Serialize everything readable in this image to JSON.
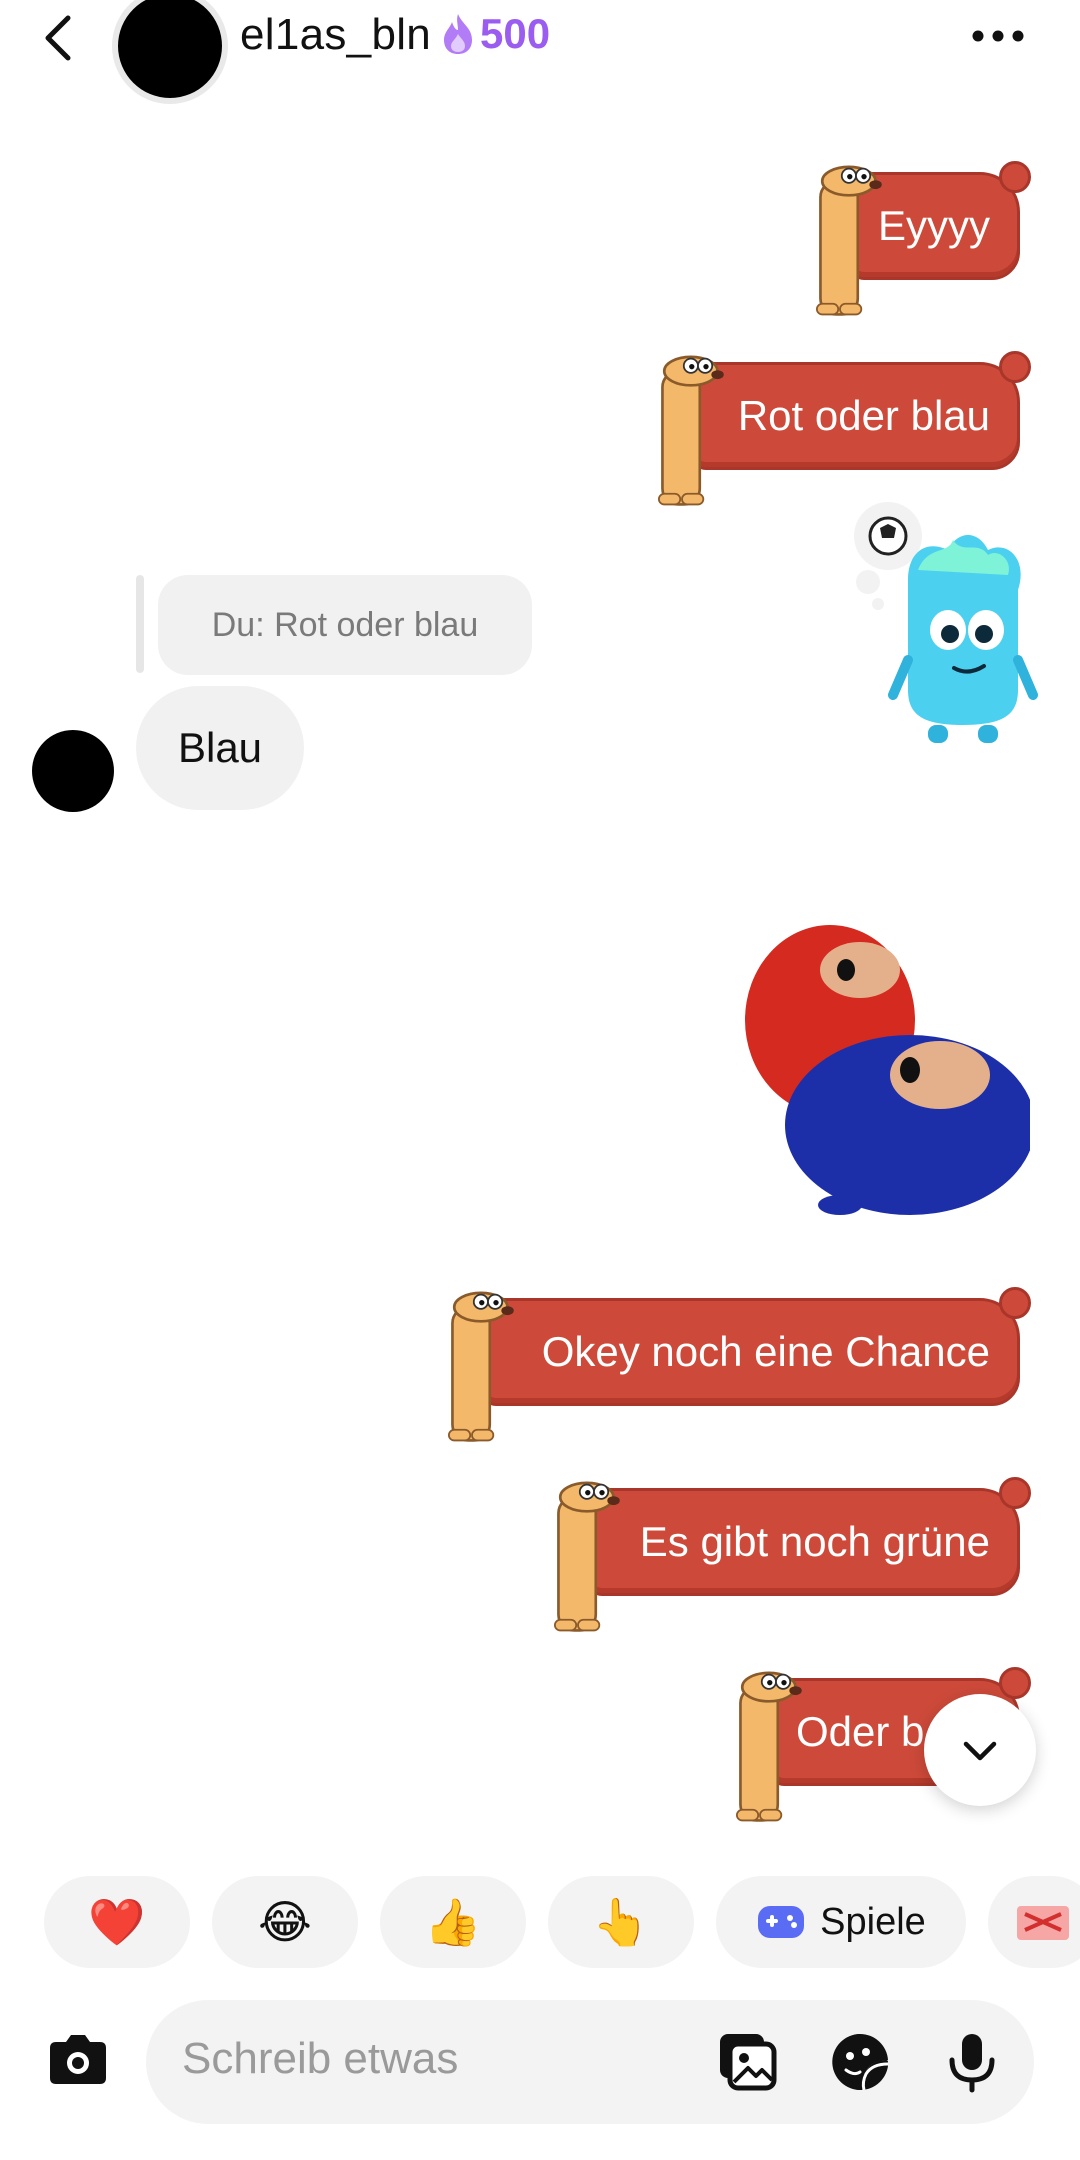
{
  "header": {
    "username": "el1as_bln",
    "streak_count": "500"
  },
  "messages": {
    "outgoing_1": "Eyyyy",
    "outgoing_2": "Rot oder blau",
    "reply_quote": "Du: Rot oder blau",
    "incoming_1": "Blau",
    "outgoing_3": "Okey noch eine Chance",
    "outgoing_4": "Es gibt noch grüne",
    "outgoing_5": "Oder b"
  },
  "quick_reactions": {
    "heart": "❤️",
    "laugh": "😂",
    "thumbs_up": "👍",
    "point": "👆",
    "games_label": "Spiele"
  },
  "composer": {
    "placeholder": "Schreib etwas"
  },
  "colors": {
    "bubble_red": "#cd4a3a",
    "streak_purple": "#9b5cf0",
    "bubble_gray": "#f1f1f1"
  },
  "icons": [
    "back-icon",
    "more-icon",
    "flame-icon",
    "gamepad-icon",
    "gift-icon",
    "camera-icon",
    "gallery-icon",
    "sticker-icon",
    "microphone-icon",
    "chevron-down-icon"
  ]
}
